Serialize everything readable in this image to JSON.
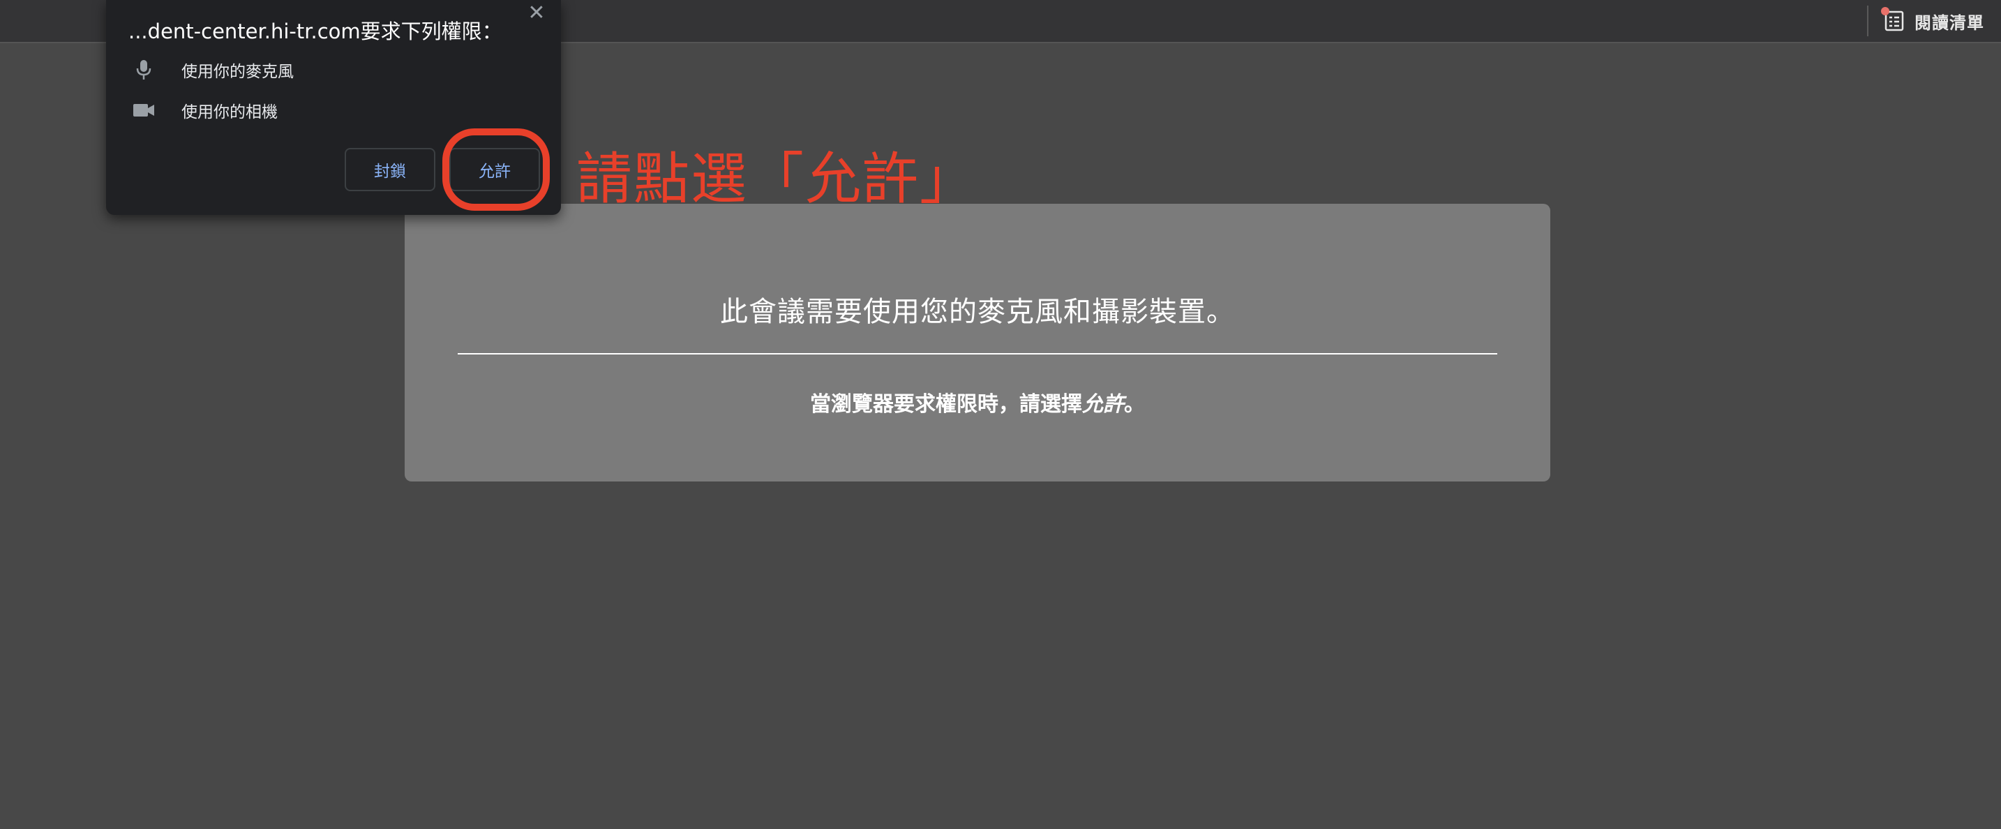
{
  "toolbar": {
    "reading_list_label": "閱讀清單",
    "reading_list_icon": "reading-list-icon"
  },
  "permission_popup": {
    "title": "...dent-center.hi-tr.com要求下列權限：",
    "close_icon": "close-icon",
    "permissions": [
      {
        "icon": "microphone-icon",
        "label": "使用你的麥克風"
      },
      {
        "icon": "camera-icon",
        "label": "使用你的相機"
      }
    ],
    "block_label": "封鎖",
    "allow_label": "允許",
    "accent_color": "#8ab4f8"
  },
  "annotation": {
    "text": "請點選「允許」",
    "color": "#e8402a"
  },
  "card": {
    "heading": "此會議需要使用您的麥克風和攝影裝置。",
    "instruction_prefix": "當瀏覽器要求權限時，請選擇",
    "instruction_emphasis": "允許",
    "instruction_suffix": "。"
  }
}
